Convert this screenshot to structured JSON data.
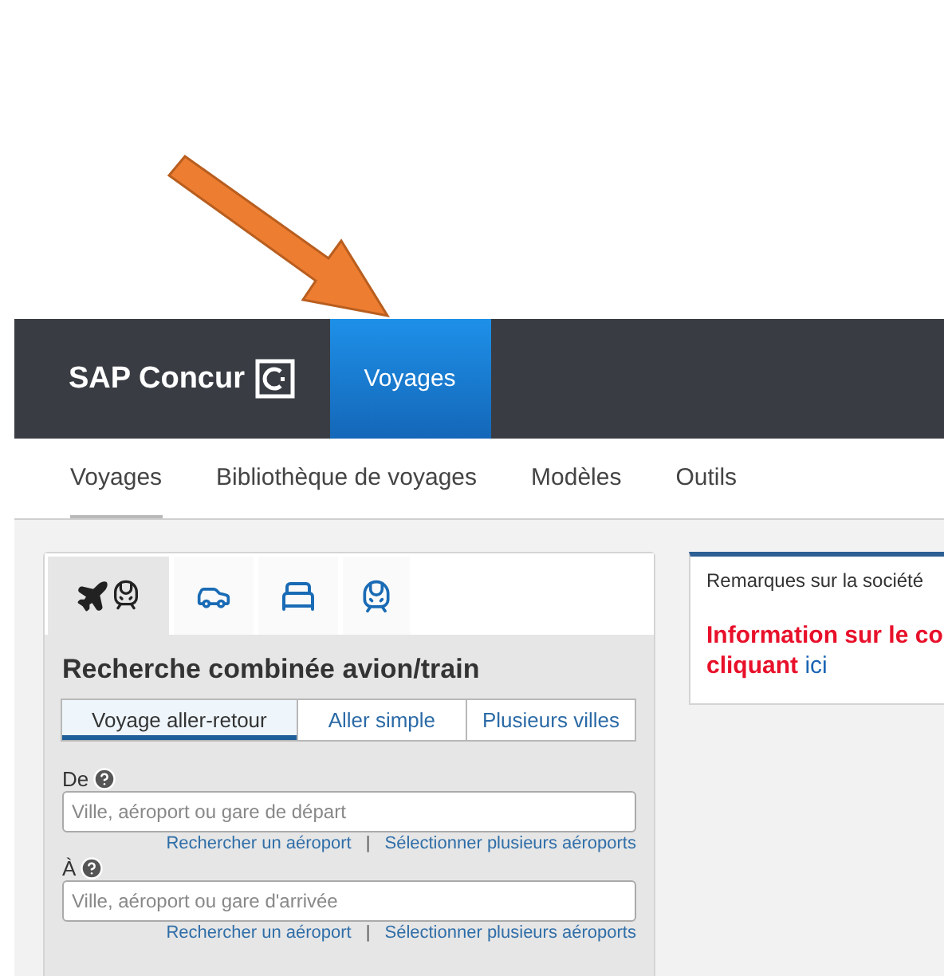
{
  "header": {
    "logo": "SAP Concur",
    "tabs": [
      {
        "label": "Voyages",
        "selected": true
      }
    ]
  },
  "subnav": [
    {
      "label": "Voyages",
      "selected": true
    },
    {
      "label": "Bibliothèque de voyages",
      "selected": false
    },
    {
      "label": "Modèles",
      "selected": false
    },
    {
      "label": "Outils",
      "selected": false
    }
  ],
  "booking": {
    "mode_tabs": [
      {
        "kind": "air_rail",
        "selected": true
      },
      {
        "kind": "car",
        "selected": false
      },
      {
        "kind": "hotel",
        "selected": false
      },
      {
        "kind": "rail",
        "selected": false
      }
    ],
    "title": "Recherche combinée avion/train",
    "trip_types": [
      {
        "label": "Voyage aller-retour",
        "selected": true
      },
      {
        "label": "Aller simple",
        "selected": false
      },
      {
        "label": "Plusieurs villes",
        "selected": false
      }
    ],
    "fields": [
      {
        "label": "De",
        "placeholder": "Ville, aéroport ou gare de départ",
        "links": [
          "Rechercher un aéroport",
          "Sélectionner plusieurs aéroports"
        ],
        "separator": "|"
      },
      {
        "label": "À",
        "placeholder": "Ville, aéroport ou gare d'arrivée",
        "links": [
          "Rechercher un aéroport",
          "Sélectionner plusieurs aéroports"
        ],
        "separator": "|"
      }
    ]
  },
  "notes": {
    "title": "Remarques sur la société",
    "message_line1": "Information sur le co",
    "message_line2": "cliquant",
    "link": "ici"
  }
}
